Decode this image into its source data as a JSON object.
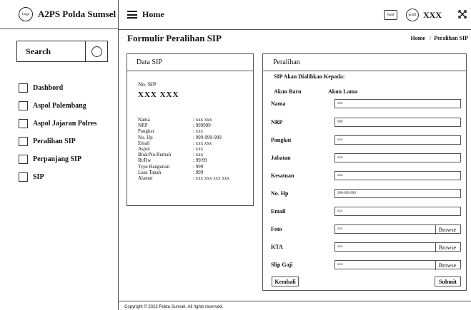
{
  "brand": {
    "logo_text": "Logo",
    "title": "A2PS Polda Sumsel"
  },
  "search": {
    "label": "Search"
  },
  "sidebar": {
    "items": [
      {
        "label": "Dashbord"
      },
      {
        "label": "Aspol Palembang"
      },
      {
        "label": "Aspol Jajaran Polres"
      },
      {
        "label": "Peralihan SIP"
      },
      {
        "label": "Perpanjang SIP"
      },
      {
        "label": "SIP"
      }
    ]
  },
  "topbar": {
    "title": "Home",
    "notif_label": "Notif",
    "profile_label": "profil",
    "user_name": "XXX"
  },
  "page": {
    "title": "Formulir Peralihan SIP",
    "breadcrumb_home": "Home",
    "breadcrumb_sep": "/",
    "breadcrumb_current": "Peralihan SIP"
  },
  "data_sip": {
    "header": "Data SIP",
    "no_label": "No. SIP",
    "no_value": "XXX XXX",
    "fields": [
      {
        "key": "Nama",
        "value": ": xxx xxx"
      },
      {
        "key": "NRP",
        "value": ": 999999"
      },
      {
        "key": "Pangkat",
        "value": ": xxx"
      },
      {
        "key": "No. Hp",
        "value": ": 999-999-999"
      },
      {
        "key": "Email",
        "value": ": xxx xxx"
      },
      {
        "key": "Aspol",
        "value": ": xxx"
      },
      {
        "key": "Blok/No.Rumah",
        "value": ": xxx"
      },
      {
        "key": "Rt/Rw",
        "value": ": 99/99"
      },
      {
        "key": "Type Bangunan",
        "value": ": 999"
      },
      {
        "key": "Luas Tanah",
        "value": ": 999"
      },
      {
        "key": "Alamat",
        "value": ": xxx xxx xxx xxx"
      }
    ]
  },
  "peralihan": {
    "header": "Peralihan",
    "subtitle": "SIP Akan Dialihkan Kepada:",
    "col_baru": "Akun Baru",
    "col_lama": "Akun Lama",
    "fields": [
      {
        "label": "Nama",
        "value": "xxx"
      },
      {
        "label": "NRP",
        "value": "999"
      },
      {
        "label": "Pangkat",
        "value": "xxx"
      },
      {
        "label": "Jabatan",
        "value": "xxx"
      },
      {
        "label": "Kesatuan",
        "value": "xxx"
      },
      {
        "label": "No. Hp",
        "value": "999-999-999"
      },
      {
        "label": "Email",
        "value": "xxx"
      },
      {
        "label": "Foto",
        "value": "xxx",
        "browse": "Browse"
      },
      {
        "label": "KTA",
        "value": "xxx",
        "browse": "Browse"
      },
      {
        "label": "Slip Gaji",
        "value": "xxx",
        "browse": "Browse"
      }
    ],
    "back_label": "Kembali",
    "submit_label": "Submit"
  },
  "footer": {
    "text": "Copyright © 2022 Polda Sumsel. All rights reserved."
  }
}
